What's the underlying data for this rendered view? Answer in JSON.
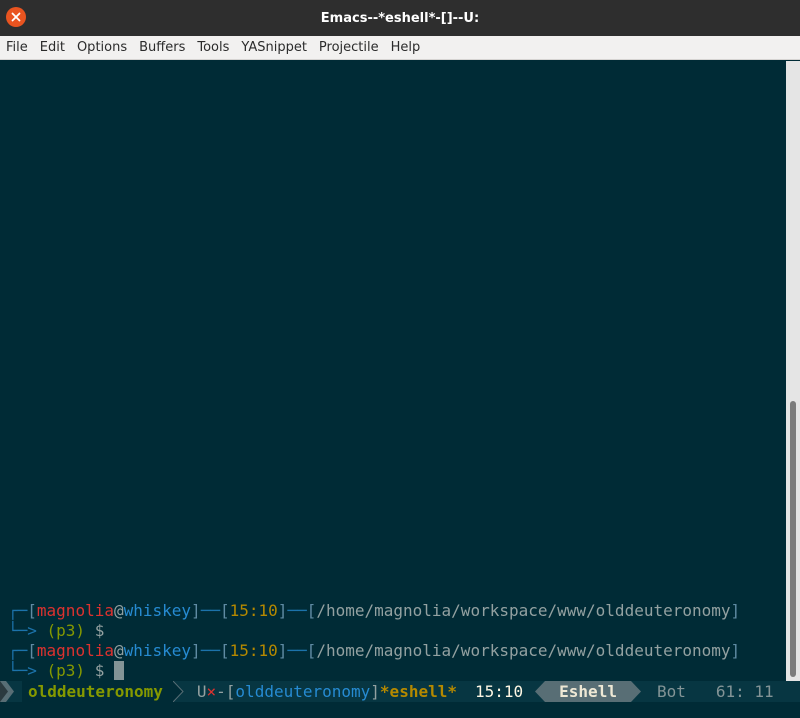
{
  "window": {
    "title": "Emacs--*eshell*-[]--U:"
  },
  "menu": {
    "items": [
      "File",
      "Edit",
      "Options",
      "Buffers",
      "Tools",
      "YASnippet",
      "Projectile",
      "Help"
    ]
  },
  "eshell": {
    "prompts": [
      {
        "user": "magnolia",
        "at": "@",
        "host": "whiskey",
        "time": "15:10",
        "path": "/home/magnolia/workspace/www/olddeuteronomy",
        "venv": "(p3)",
        "symbol": "$"
      },
      {
        "user": "magnolia",
        "at": "@",
        "host": "whiskey",
        "time": "15:10",
        "path": "/home/magnolia/workspace/www/olddeuteronomy",
        "venv": "(p3)",
        "symbol": "$"
      }
    ]
  },
  "modeline": {
    "project": "olddeuteronomy",
    "encoding": "U",
    "modified_flag": "×",
    "project_bracketed": "olddeuteronomy",
    "buffer_name": "*eshell*",
    "time": "15:10",
    "major_mode": "Eshell",
    "position": "Bot",
    "line_col": "61: 11"
  },
  "colors": {
    "background": "#002b36",
    "modeline": "#073642",
    "red": "#dc322f",
    "blue": "#268bd2",
    "yellow": "#b58900",
    "green": "#859900"
  }
}
